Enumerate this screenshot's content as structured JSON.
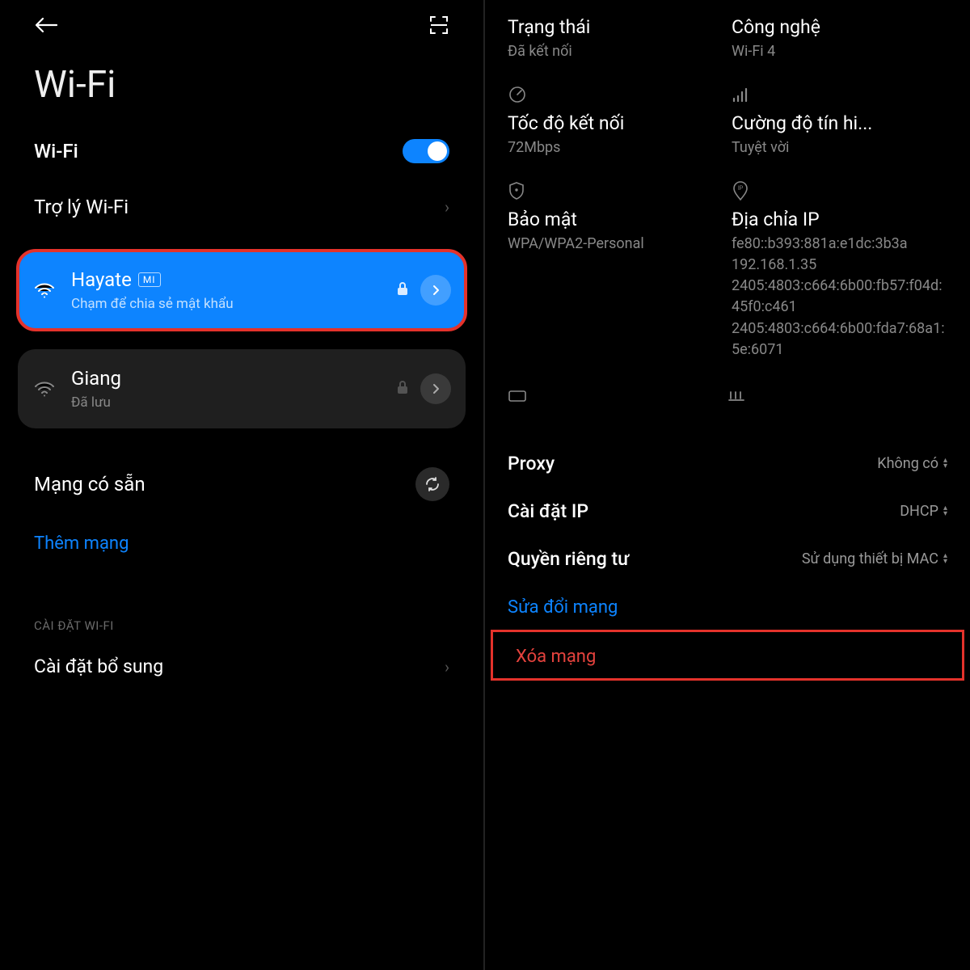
{
  "left": {
    "title": "Wi-Fi",
    "wifi_label": "Wi-Fi",
    "assistant_label": "Trợ lý Wi-Fi",
    "network_active": {
      "name": "Hayate",
      "badge": "MI",
      "subtitle": "Chạm để chia sẻ mật khẩu"
    },
    "network_saved": {
      "name": "Giang",
      "subtitle": "Đã lưu"
    },
    "available_label": "Mạng có sẵn",
    "add_network": "Thêm mạng",
    "section_header": "CÀI ĐẶT WI-FI",
    "extra_settings": "Cài đặt bổ sung"
  },
  "right": {
    "status": {
      "title": "Trạng thái",
      "value": "Đã kết nối"
    },
    "tech": {
      "title": "Công nghệ",
      "value": "Wi-Fi 4"
    },
    "speed": {
      "title": "Tốc độ kết nối",
      "value": "72Mbps"
    },
    "signal": {
      "title": "Cường độ tín hi...",
      "value": "Tuyệt vời"
    },
    "security": {
      "title": "Bảo mật",
      "value": "WPA/WPA2-Personal"
    },
    "ip": {
      "title": "Địa chỉa IP",
      "value": "fe80::b393:881a:e1dc:3b3a\n192.168.1.35\n2405:4803:c664:6b00:fb57:f04d:45f0:c461\n2405:4803:c664:6b00:fda7:68a1:5e:6071"
    },
    "proxy": {
      "label": "Proxy",
      "value": "Không có"
    },
    "ipset": {
      "label": "Cài đặt IP",
      "value": "DHCP"
    },
    "privacy": {
      "label": "Quyền riêng tư",
      "value": "Sử dụng thiết bị MAC"
    },
    "modify": "Sửa đổi mạng",
    "forget": "Xóa mạng"
  }
}
